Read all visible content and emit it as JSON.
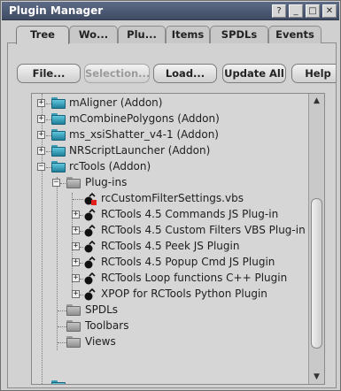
{
  "window": {
    "title": "Plugin Manager",
    "controls": {
      "help": "?",
      "minimize": "_",
      "maximize": "□",
      "close": "✕"
    }
  },
  "tabs": [
    {
      "label": "Tree",
      "active": true
    },
    {
      "label": "Wo..."
    },
    {
      "label": "Plu..."
    },
    {
      "label": "Items"
    },
    {
      "label": "SPDLs"
    },
    {
      "label": "Events"
    }
  ],
  "toolbar": {
    "file": "File...",
    "selection": "Selection...",
    "load": "Load...",
    "update_all": "Update All",
    "help": "Help"
  },
  "tree": {
    "items": [
      {
        "label": "mAligner (Addon)",
        "type": "addon"
      },
      {
        "label": "mCombinePolygons (Addon)",
        "type": "addon"
      },
      {
        "label": "ms_xsiShatter_v4-1 (Addon)",
        "type": "addon"
      },
      {
        "label": "NRScriptLauncher (Addon)",
        "type": "addon"
      },
      {
        "label": "rcTools (Addon)",
        "type": "addon",
        "expanded": true
      },
      {
        "label": "Plug-ins",
        "type": "folder",
        "expanded": true
      },
      {
        "label": "rcCustomFilterSettings.vbs",
        "type": "plugin-error"
      },
      {
        "label": "RCTools 4.5 Commands JS Plug-in",
        "type": "plugin"
      },
      {
        "label": "RCTools 4.5 Custom Filters VBS Plug-in",
        "type": "plugin"
      },
      {
        "label": "RCTools 4.5 Peek JS Plugin",
        "type": "plugin"
      },
      {
        "label": "RCTools 4.5 Popup Cmd JS Plugin",
        "type": "plugin"
      },
      {
        "label": "RCTools Loop functions C++ Plugin",
        "type": "plugin"
      },
      {
        "label": "XPOP for RCTools Python Plugin",
        "type": "plugin"
      },
      {
        "label": "SPDLs",
        "type": "folder"
      },
      {
        "label": "Toolbars",
        "type": "folder"
      },
      {
        "label": "Views",
        "type": "folder"
      }
    ]
  }
}
